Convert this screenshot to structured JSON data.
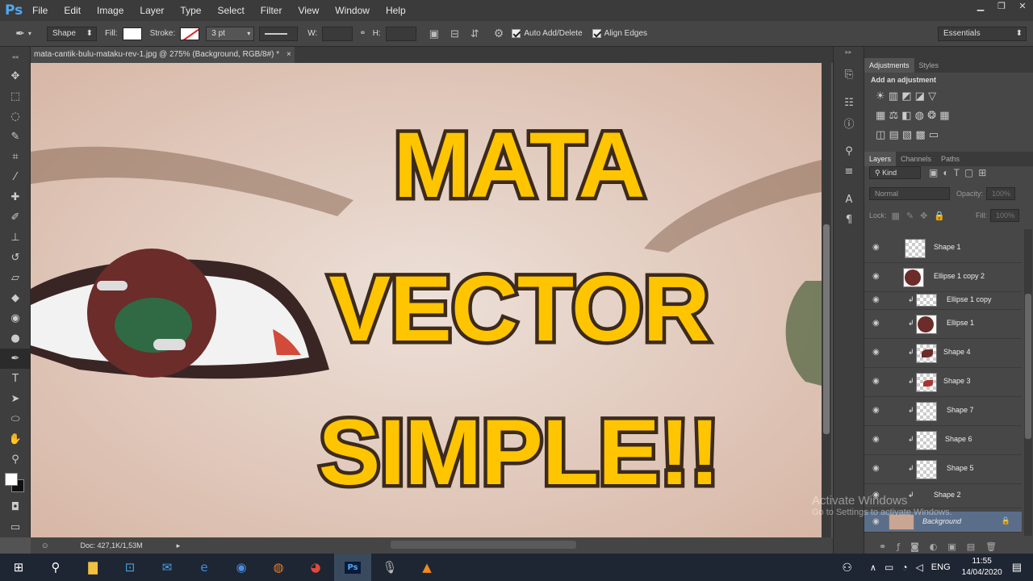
{
  "app": {
    "logo": "Ps"
  },
  "menu": [
    "File",
    "Edit",
    "Image",
    "Layer",
    "Type",
    "Select",
    "Filter",
    "View",
    "Window",
    "Help"
  ],
  "options": {
    "mode": "Shape",
    "fill_label": "Fill:",
    "stroke_label": "Stroke:",
    "stroke_width": "3 pt",
    "w_label": "W:",
    "h_label": "H:",
    "auto_add": "Auto Add/Delete",
    "align_edges": "Align Edges",
    "workspace": "Essentials"
  },
  "document": {
    "tab": "mata-cantik-bulu-mataku-rev-1.jpg @ 275% (Background, RGB/8#) *",
    "close": "×"
  },
  "overlay": {
    "line1": "MATA",
    "line2": "VECTOR",
    "line3": "SIMPLE!!"
  },
  "status": {
    "doc": "Doc: 427,1K/1,53M"
  },
  "adjustments": {
    "tabs": [
      "Adjustments",
      "Styles"
    ],
    "heading": "Add an adjustment"
  },
  "layers_panel": {
    "tabs": [
      "Layers",
      "Channels",
      "Paths"
    ],
    "kind": "Kind",
    "blend": "Normal",
    "opacity_label": "Opacity:",
    "opacity": "100%",
    "lock_label": "Lock:",
    "fill_label": "Fill:",
    "fill": "100%",
    "layers": [
      {
        "name": "Shape 1"
      },
      {
        "name": "Ellipse 1 copy 2"
      },
      {
        "name": "Ellipse 1 copy"
      },
      {
        "name": "Ellipse 1"
      },
      {
        "name": "Shape 4"
      },
      {
        "name": "Shape 3"
      },
      {
        "name": "Shape 7"
      },
      {
        "name": "Shape 6"
      },
      {
        "name": "Shape 5"
      },
      {
        "name": "Shape 2"
      },
      {
        "name": "Background"
      }
    ]
  },
  "watermark": {
    "line1": "Activate Windows",
    "line2": "Go to Settings to activate Windows."
  },
  "taskbar": {
    "lang": "ENG",
    "time": "11:55",
    "date": "14/04/2020"
  },
  "colors": {
    "title_fill": "#fec500",
    "title_stroke": "#3c2a1d",
    "iris": "#6b2c2a",
    "pupil": "#2f6a45",
    "skin": "#dcc3b6"
  }
}
